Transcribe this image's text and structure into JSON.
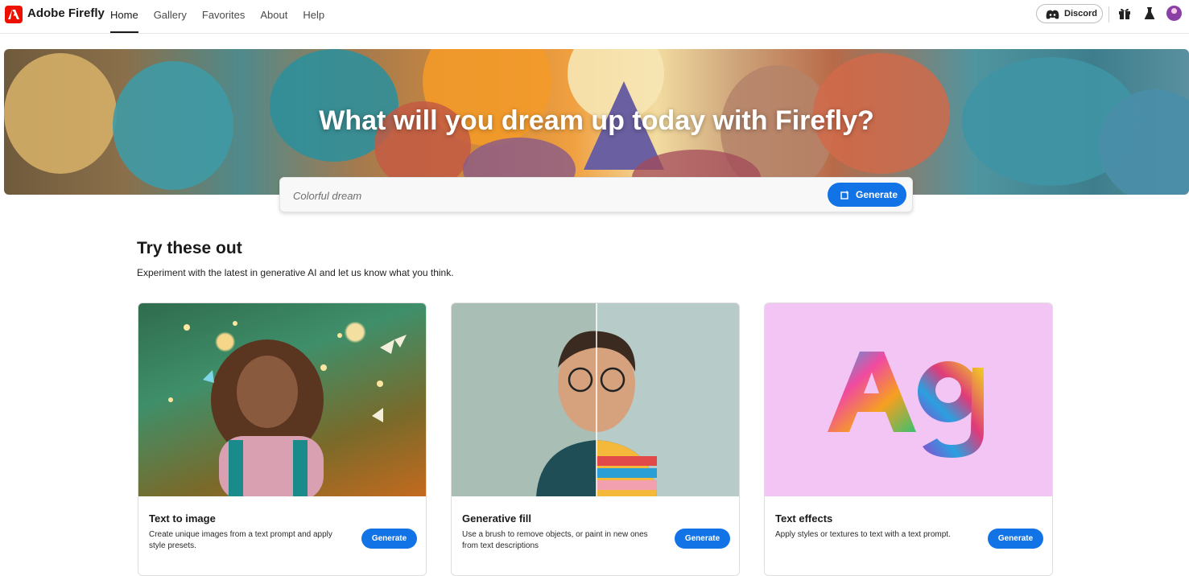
{
  "app": {
    "brand": "Adobe Firefly"
  },
  "nav": {
    "items": [
      {
        "label": "Home",
        "active": true
      },
      {
        "label": "Gallery",
        "active": false
      },
      {
        "label": "Favorites",
        "active": false
      },
      {
        "label": "About",
        "active": false
      },
      {
        "label": "Help",
        "active": false
      }
    ]
  },
  "toolbar": {
    "discord_label": "Discord",
    "icons": [
      "gift-icon",
      "flask-icon",
      "avatar"
    ]
  },
  "hero": {
    "title": "What will you dream up today with Firefly?",
    "prompt_placeholder": "Colorful dream",
    "generate_label": "Generate"
  },
  "section": {
    "title": "Try these out",
    "subtitle": "Experiment with the latest in generative AI and let us know what you think."
  },
  "cards": [
    {
      "title": "Text to image",
      "description": "Create unique images from a text prompt and apply style presets.",
      "button": "Generate",
      "image": "girl-with-butterflies"
    },
    {
      "title": "Generative fill",
      "description": "Use a brush to remove objects, or paint in new ones from text descriptions",
      "button": "Generate",
      "image": "split-portrait"
    },
    {
      "title": "Text effects",
      "description": "Apply styles or textures to text with a text prompt.",
      "button": "Generate",
      "image": "furry-ag-letters"
    }
  ],
  "colors": {
    "accent": "#1273e6",
    "brand": "#eb1000"
  }
}
